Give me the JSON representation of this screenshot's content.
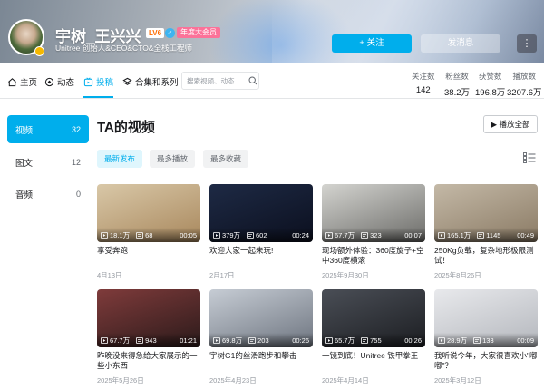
{
  "profile": {
    "name": "宇树_王兴兴",
    "level": "LV6",
    "vip": "年度大会员",
    "sign": "Unitree 创始人&CEO&CTO&全栈工程师",
    "follow_label": "+ 关注",
    "message_label": "发消息",
    "more_label": "⋮"
  },
  "nav": {
    "items": [
      {
        "label": "主页",
        "icon": "home-icon"
      },
      {
        "label": "动态",
        "icon": "dynamic-icon"
      },
      {
        "label": "投稿",
        "icon": "upload-icon"
      },
      {
        "label": "合集和系列",
        "icon": "collection-icon"
      }
    ],
    "active": "投稿",
    "search_placeholder": "搜索视频、动态"
  },
  "stats": [
    {
      "label": "关注数",
      "value": "142"
    },
    {
      "label": "粉丝数",
      "value": "38.2万"
    },
    {
      "label": "获赞数",
      "value": "196.8万"
    },
    {
      "label": "播放数",
      "value": "3207.6万"
    }
  ],
  "sidebar": [
    {
      "label": "视频",
      "count": "32"
    },
    {
      "label": "图文",
      "count": "12"
    },
    {
      "label": "音频",
      "count": "0"
    }
  ],
  "section_title": "TA的视频",
  "play_all_label": "▶ 播放全部",
  "sort_options": [
    "最新发布",
    "最多播放",
    "最多收藏"
  ],
  "videos": [
    {
      "views": "18.1万",
      "danmaku": "68",
      "duration": "00:05",
      "title": "享受奔跑",
      "date": "4月13日",
      "thumb": [
        "#d9c8a8",
        "#a8875c"
      ]
    },
    {
      "views": "379万",
      "danmaku": "602",
      "duration": "00:24",
      "title": "欢迎大家一起来玩!",
      "date": "2月17日",
      "thumb": [
        "#1e2a45",
        "#0b0f1e"
      ]
    },
    {
      "views": "67.7万",
      "danmaku": "323",
      "duration": "00:07",
      "title": "现场额外体验：360度旋子+空中360度横滚",
      "date": "2025年9月30日",
      "thumb": [
        "#d4d4d0",
        "#6b6b68"
      ]
    },
    {
      "views": "165.1万",
      "danmaku": "1145",
      "duration": "00:49",
      "title": "250Kg负载，复杂地形极限测试！",
      "date": "2025年8月26日",
      "thumb": [
        "#c4b9a7",
        "#8a7a64"
      ]
    },
    {
      "views": "67.7万",
      "danmaku": "943",
      "duration": "01:21",
      "title": "昨晚没来得急给大家展示的一些小东西",
      "date": "2025年5月26日",
      "thumb": [
        "#7f3b3b",
        "#2b1a1a"
      ]
    },
    {
      "views": "69.8万",
      "danmaku": "203",
      "duration": "00:26",
      "title": "宇树G1的丝滑跑步和攀击",
      "date": "2025年4月23日",
      "thumb": [
        "#c6ccd4",
        "#6e7580"
      ]
    },
    {
      "views": "65.7万",
      "danmaku": "755",
      "duration": "00:26",
      "title": "一镜到底！Unitree 铁甲拳王",
      "date": "2025年4月14日",
      "thumb": [
        "#4a4e56",
        "#1c1e22"
      ]
    },
    {
      "views": "28.9万",
      "danmaku": "133",
      "duration": "00:09",
      "title": "我听说今年，大家很喜欢小\"嘟嘟\"？",
      "date": "2025年3月12日",
      "thumb": [
        "#e8e9ec",
        "#b4b7bd"
      ]
    }
  ],
  "colors": {
    "accent": "#00aeec",
    "vip": "#fb7299",
    "level": "#ff6b00"
  }
}
